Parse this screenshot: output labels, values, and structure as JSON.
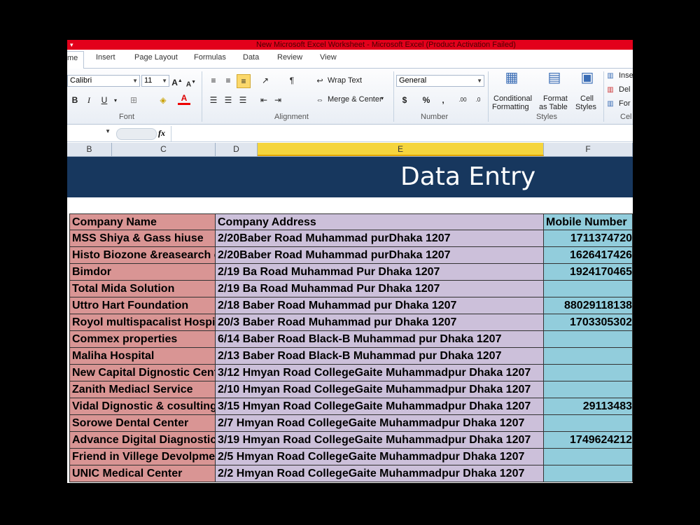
{
  "window": {
    "title": "New Microsoft Excel Worksheet  -  Microsoft Excel (Product Activation Failed)",
    "quick_access": "▾"
  },
  "ribbon_tabs": [
    "me",
    "Insert",
    "Page Layout",
    "Formulas",
    "Data",
    "Review",
    "View"
  ],
  "ribbon": {
    "font": {
      "name": "Calibri",
      "size": "11",
      "group_label": "Font"
    },
    "alignment": {
      "wrap_text": "Wrap Text",
      "merge_center": "Merge & Center",
      "group_label": "Alignment"
    },
    "number": {
      "format": "General",
      "group_label": "Number"
    },
    "styles": {
      "conditional": [
        "Conditional",
        "Formatting"
      ],
      "format_table": [
        "Format",
        "as Table"
      ],
      "cell_styles": [
        "Cell",
        "Styles"
      ],
      "group_label": "Styles"
    },
    "cells": {
      "insert": "Inse",
      "delete": "Del",
      "format": "For",
      "group_label": "Cel"
    }
  },
  "formula_bar": {
    "fx": "fx",
    "value": ""
  },
  "columns": [
    "B",
    "C",
    "D",
    "E",
    "F"
  ],
  "banner": {
    "title": "Data Entry"
  },
  "table": {
    "headers": [
      "Company Name",
      "Company  Address",
      "Mobile Number"
    ],
    "rows": [
      [
        "MSS Shiya & Gass hiuse",
        "2/20Baber Road Muhammad purDhaka 1207",
        "1711374720"
      ],
      [
        "Histo Biozone &reasearch c",
        "2/20Baber Road Muhammad purDhaka 1207",
        "1626417426"
      ],
      [
        "Bimdor",
        "2/19 Ba  Road Muhammad Pur Dhaka 1207",
        "1924170465"
      ],
      [
        "Total Mida Solution",
        "2/19 Ba  Road Muhammad Pur Dhaka 1207",
        ""
      ],
      [
        "Uttro Hart Foundation",
        "2/18 Baber Road Muhammad pur Dhaka 1207",
        "88029118138"
      ],
      [
        "Royol multispacalist Hospita",
        "20/3 Baber Road Muhammad pur Dhaka 1207",
        "1703305302"
      ],
      [
        "Commex properties",
        "6/14 Baber Road Black-B  Muhammad pur Dhaka 1207",
        ""
      ],
      [
        "Maliha Hospital",
        "2/13 Baber Road Black-B  Muhammad pur Dhaka 1207",
        ""
      ],
      [
        "New Capital Dignostic Cente",
        "3/12 Hmyan Road CollegeGaite Muhammadpur Dhaka 1207",
        ""
      ],
      [
        "Zanith Mediacl Service",
        "2/10 Hmyan Road CollegeGaite Muhammadpur Dhaka 1207",
        ""
      ],
      [
        "Vidal Dignostic & cosulting c",
        "3/15 Hmyan Road CollegeGaite Muhammadpur Dhaka 1207",
        "29113483"
      ],
      [
        "Sorowe Dental Center",
        "2/7  Hmyan Road CollegeGaite Muhammadpur Dhaka 1207",
        ""
      ],
      [
        "Advance Digital Diagnostic S",
        "3/19  Hmyan Road CollegeGaite Muhammadpur Dhaka 1207",
        "1749624212"
      ],
      [
        "Friend in Villege Devolpmen",
        "2/5  Hmyan Road CollegeGaite Muhammadpur Dhaka 1207",
        ""
      ],
      [
        "UNIC Medical Center",
        "2/2   Hmyan Road CollegeGaite Muhammadpur Dhaka 1207",
        ""
      ]
    ]
  },
  "colors": {
    "title_bar": "#e3001b",
    "banner": "#17375e",
    "company_col": "#d99594",
    "address_col": "#ccc0da",
    "mobile_col": "#92cddc",
    "selected_col_header": "#f5d53d"
  }
}
